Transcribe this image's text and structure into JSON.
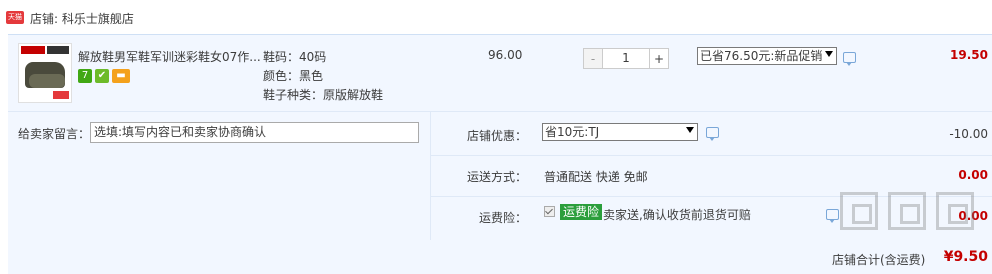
{
  "shop": {
    "badge": "天猫",
    "label": "店铺: 科乐士旗舰店"
  },
  "item": {
    "title": "解放鞋男军鞋军训迷彩鞋女07作...",
    "badge_icons": [
      "seven-day-return-icon",
      "guarantee-icon",
      "credit-card-icon"
    ],
    "badge_seven": "7",
    "sku_size": "鞋码：40码",
    "sku_color": "颜色：黑色",
    "sku_type": "鞋子种类：原版解放鞋",
    "unit_price": "96.00",
    "quantity": "1",
    "minus": "-",
    "plus": "+",
    "promotion": "已省76.50元:新品促销",
    "subtotal": "19.50"
  },
  "message": {
    "label": "给卖家留言：",
    "placeholder": "选填:填写内容已和卖家协商确认"
  },
  "coupon": {
    "label": "店铺优惠：",
    "selected": "省10元:TJ",
    "value": "-10.00"
  },
  "shipping": {
    "label": "运送方式：",
    "value": "普通配送 快递 免邮",
    "cost": "0.00"
  },
  "insurance": {
    "label": "运费险：",
    "badge": "运费险",
    "text": "卖家送,确认收货前退货可赔",
    "cost": "0.00"
  },
  "total": {
    "label": "店铺合计(含运费)",
    "value": "¥9.50"
  },
  "colors": {
    "accent_red": "#c40000",
    "panel_bg": "#f2f7ff",
    "insurance_green": "#2b9e3c"
  }
}
